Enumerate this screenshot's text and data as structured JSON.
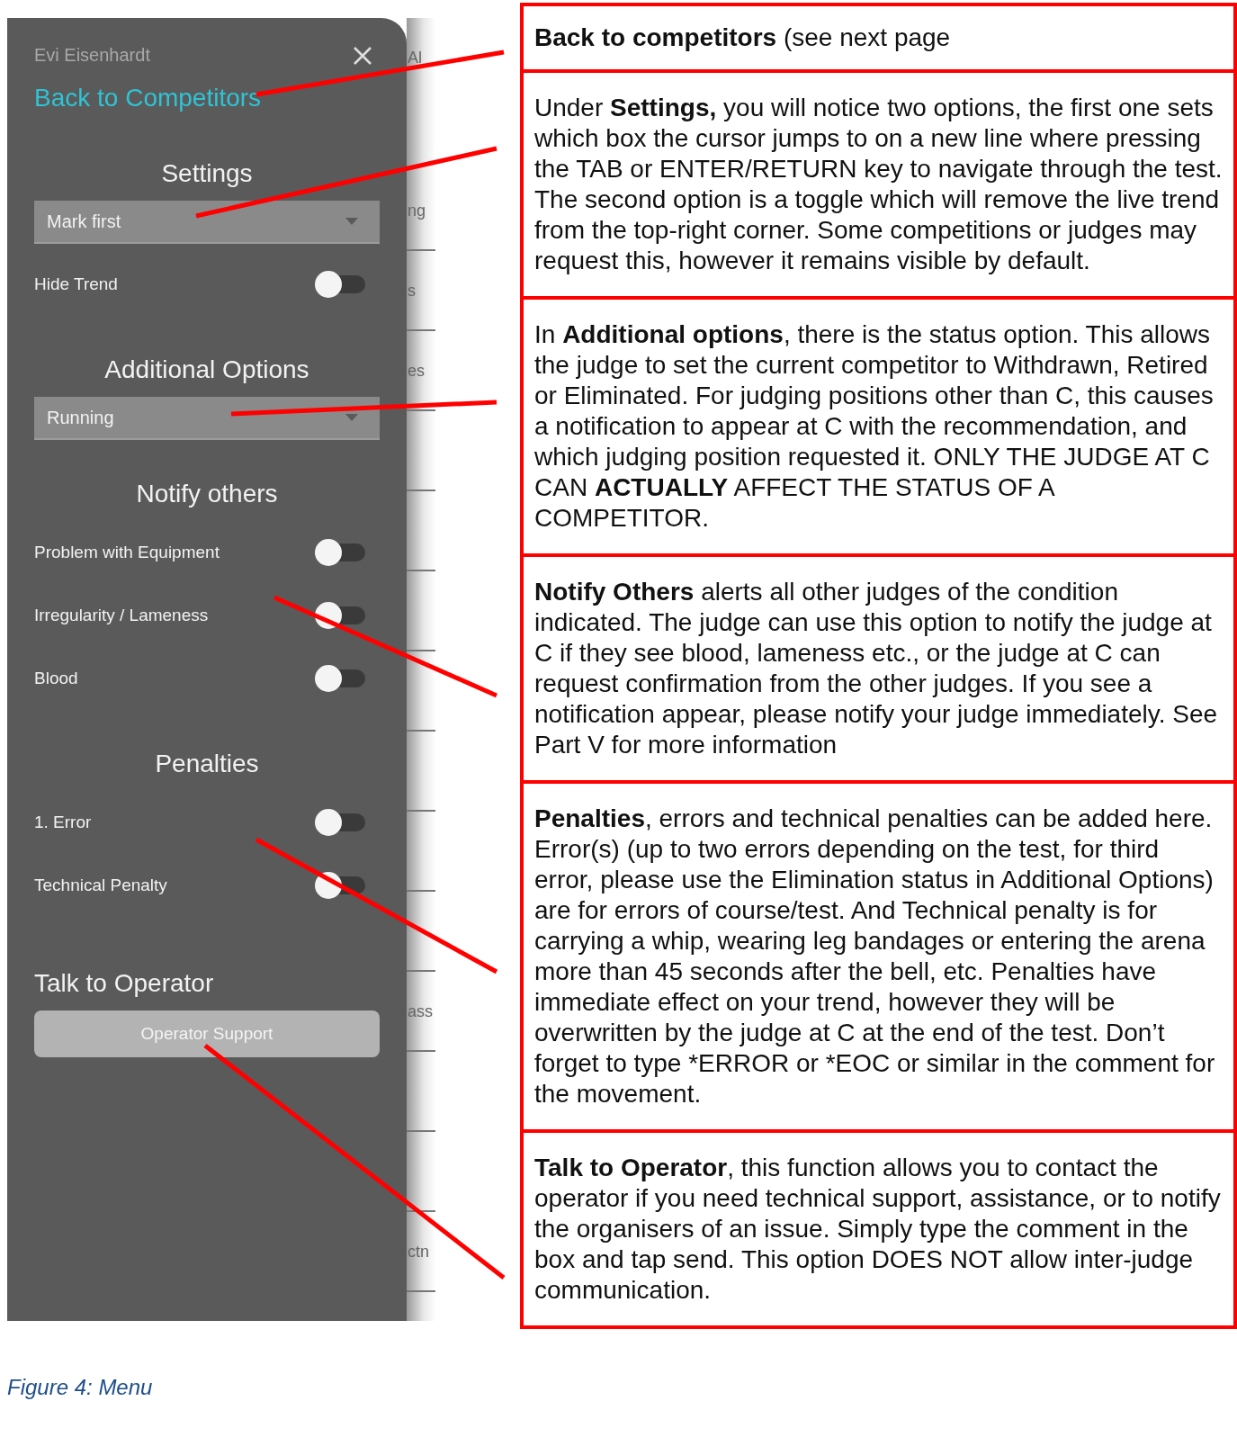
{
  "menu": {
    "user_name": "Evi Eisenhardt",
    "back_link": "Back to Competitors",
    "sections": [
      {
        "kind": "group",
        "title": "Settings",
        "items": [
          {
            "kind": "dropdown",
            "value": "Mark first"
          },
          {
            "kind": "toggle",
            "label": "Hide Trend",
            "on": false
          }
        ]
      },
      {
        "kind": "group",
        "title": "Additional Options",
        "items": [
          {
            "kind": "dropdown",
            "value": "Running"
          }
        ]
      },
      {
        "kind": "group",
        "title": "Notify others",
        "items": [
          {
            "kind": "toggle",
            "label": "Problem with Equipment",
            "on": false
          },
          {
            "kind": "toggle",
            "label": "Irregularity / Lameness",
            "on": false
          },
          {
            "kind": "toggle",
            "label": "Blood",
            "on": false
          }
        ]
      },
      {
        "kind": "group",
        "title": "Penalties",
        "items": [
          {
            "kind": "toggle",
            "label": "1. Error",
            "on": false
          },
          {
            "kind": "toggle",
            "label": "Technical Penalty",
            "on": false
          }
        ]
      },
      {
        "kind": "contact",
        "title": "Talk to Operator",
        "items": [
          {
            "kind": "button",
            "label": "Operator Support",
            "disabled": true
          }
        ]
      }
    ]
  },
  "background_strip": [
    {
      "text": "Al"
    },
    {
      "text": "ng"
    },
    {
      "text": "s"
    },
    {
      "text": "es"
    },
    {
      "text": "ass"
    },
    {
      "text": "ctn"
    }
  ],
  "caption": "Figure 4: Menu",
  "notes": [
    "**Back to competitors** (see next page",
    "Under **Settings,** you will notice two options, the first one sets which box the cursor jumps to on a new line where pressing the TAB or ENTER/RETURN key to navigate through the test. The second option is a toggle which will remove the live trend from the top-right corner. Some competitions or judges may request this, however it remains visible by default.",
    "In **Additional options**, there is the status option. This allows the judge to set the current competitor to Withdrawn, Retired or Eliminated. For judging positions other than C, this causes a notification to appear at C with the recommendation, and which judging position requested it. ONLY THE JUDGE AT C CAN **ACTUALLY** AFFECT THE STATUS OF A COMPETITOR.",
    "**Notify Others** alerts all other judges of the condition indicated. The judge can use this option to notify the judge at C if they see blood, lameness etc., or the judge at C can request confirmation from the other judges. If you see a notification appear, please notify your judge immediately. See Part V for more information",
    "**Penalties**, errors and technical penalties can be added here. Error(s) (up to two errors depending on the test, for third error, please use the Elimination status in Additional Options) are for errors of course/test. And Technical penalty is for carrying a whip, wearing leg bandages or entering the arena more than 45 seconds after the bell, etc. Penalties have immediate effect on your trend, however they will be overwritten by the judge at C at the end of the test. Don’t forget to type *ERROR or *EOC or similar in the comment for the movement.",
    "**Talk to Operator**, this function allows you to contact the operator if you need technical support, assistance, or to notify the organisers of an issue. Simply type the comment in the box and tap send. This option DOES NOT allow inter-judge communication."
  ]
}
